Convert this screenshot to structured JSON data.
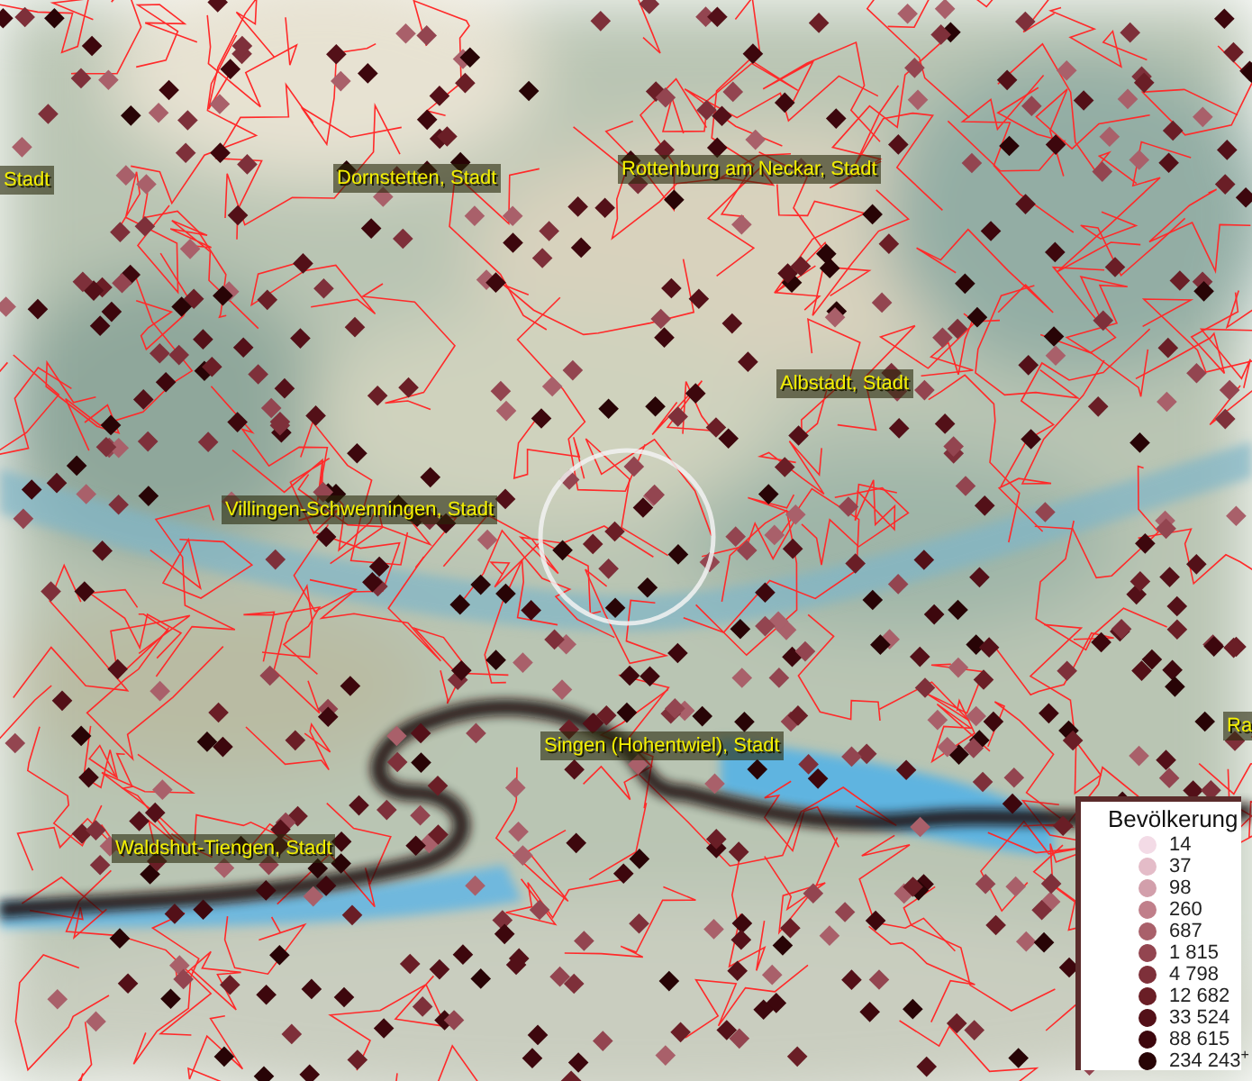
{
  "map": {
    "place_labels": [
      {
        "text": "Stadt"
      },
      {
        "text": "Dornstetten, Stadt"
      },
      {
        "text": "Rottenburg am Neckar, Stadt"
      },
      {
        "text": "Albstadt, Stadt"
      },
      {
        "text": "Villingen-Schwenningen, Stadt"
      },
      {
        "text": "Singen (Hohentwiel), Stadt"
      },
      {
        "text": "Waldshut-Tiengen, Stadt"
      },
      {
        "text": "Ra"
      }
    ]
  },
  "legend": {
    "title": "Bevölkerung",
    "entries": [
      {
        "label": "14",
        "color": "#f3dbe6"
      },
      {
        "label": "37",
        "color": "#e4bcc8"
      },
      {
        "label": "98",
        "color": "#d29fab"
      },
      {
        "label": "260",
        "color": "#c07f8a"
      },
      {
        "label": "687",
        "color": "#a9606a"
      },
      {
        "label": "1 815",
        "color": "#934550"
      },
      {
        "label": "4 798",
        "color": "#7e303a"
      },
      {
        "label": "12 682",
        "color": "#6a1e26"
      },
      {
        "label": "33 524",
        "color": "#531018"
      },
      {
        "label": "88 615",
        "color": "#3d070d"
      },
      {
        "label": "234 243$^{+}$",
        "color": "#280406"
      }
    ]
  }
}
